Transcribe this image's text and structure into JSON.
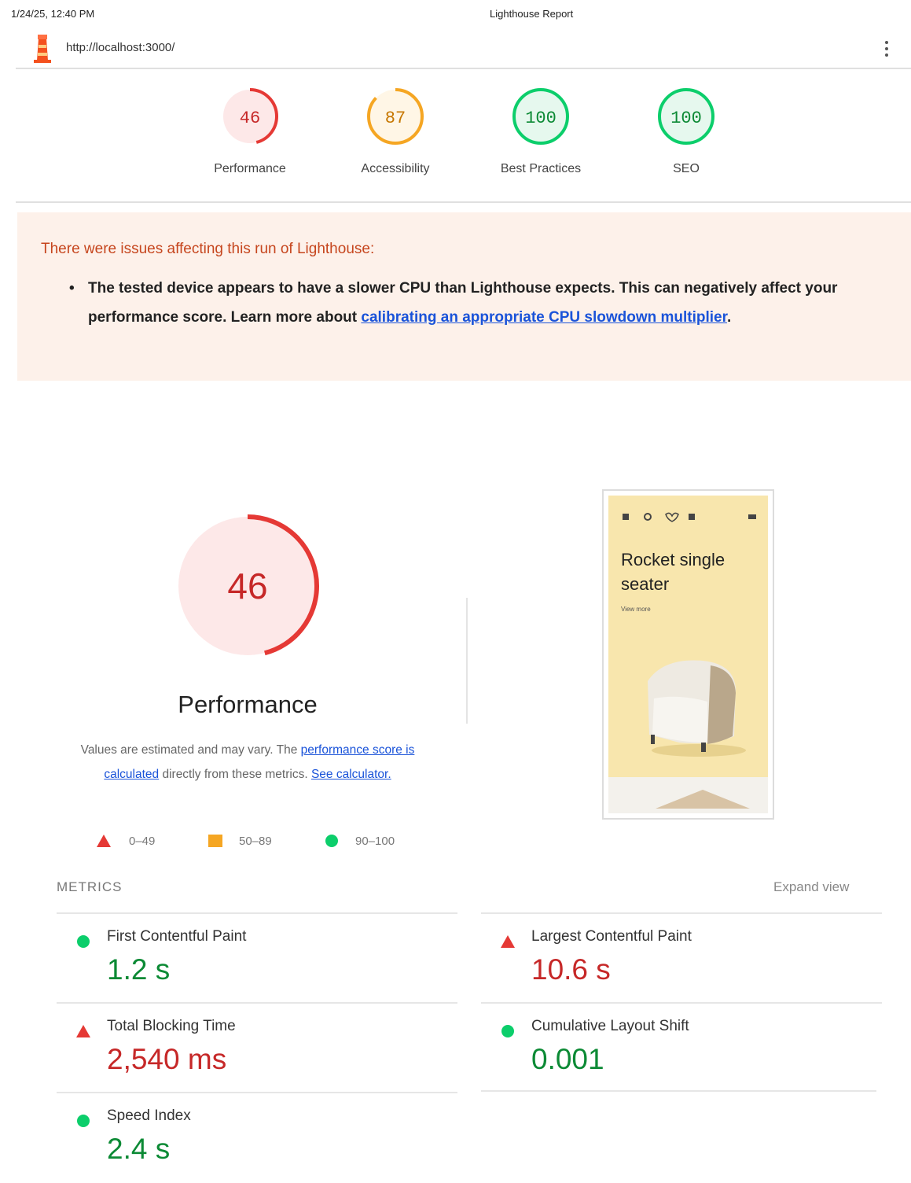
{
  "header": {
    "datetime": "1/24/25, 12:40 PM",
    "page_title": "Lighthouse Report",
    "url": "http://localhost:3000/"
  },
  "scores": [
    {
      "name": "Performance",
      "score": "46",
      "status": "fail"
    },
    {
      "name": "Accessibility",
      "score": "87",
      "status": "average"
    },
    {
      "name": "Best Practices",
      "score": "100",
      "status": "pass"
    },
    {
      "name": "SEO",
      "score": "100",
      "status": "pass"
    }
  ],
  "warning": {
    "title": "There were issues affecting this run of Lighthouse:",
    "bullet_text": "The tested device appears to have a slower CPU than Lighthouse expects. This can negatively affect your performance score. Learn more about ",
    "link_text": "calibrating an appropriate CPU slowdown multiplier",
    "trailing": "."
  },
  "performance": {
    "score": "46",
    "title": "Performance",
    "desc_prefix": "Values are estimated and may vary. The ",
    "desc_link1": "performance score is calculated",
    "desc_middle": " directly from these metrics. ",
    "desc_link2": "See calculator."
  },
  "legend": [
    {
      "range": "0–49",
      "shape": "triangle",
      "color": "#e53935"
    },
    {
      "range": "50–89",
      "shape": "square",
      "color": "#f5a623"
    },
    {
      "range": "90–100",
      "shape": "circle",
      "color": "#0cce6b"
    }
  ],
  "screenshot": {
    "title": "Rocket single seater",
    "sub": "View more"
  },
  "metrics": {
    "header": "METRICS",
    "expand": "Expand view",
    "items": [
      {
        "label": "First Contentful Paint",
        "value": "1.2 s",
        "status": "pass"
      },
      {
        "label": "Largest Contentful Paint",
        "value": "10.6 s",
        "status": "fail"
      },
      {
        "label": "Total Blocking Time",
        "value": "2,540 ms",
        "status": "fail"
      },
      {
        "label": "Cumulative Layout Shift",
        "value": "0.001",
        "status": "pass"
      },
      {
        "label": "Speed Index",
        "value": "2.4 s",
        "status": "pass"
      }
    ]
  },
  "colors": {
    "fail": "#e53935",
    "average": "#f5a623",
    "pass": "#0cce6b",
    "link": "#1a53d9"
  }
}
